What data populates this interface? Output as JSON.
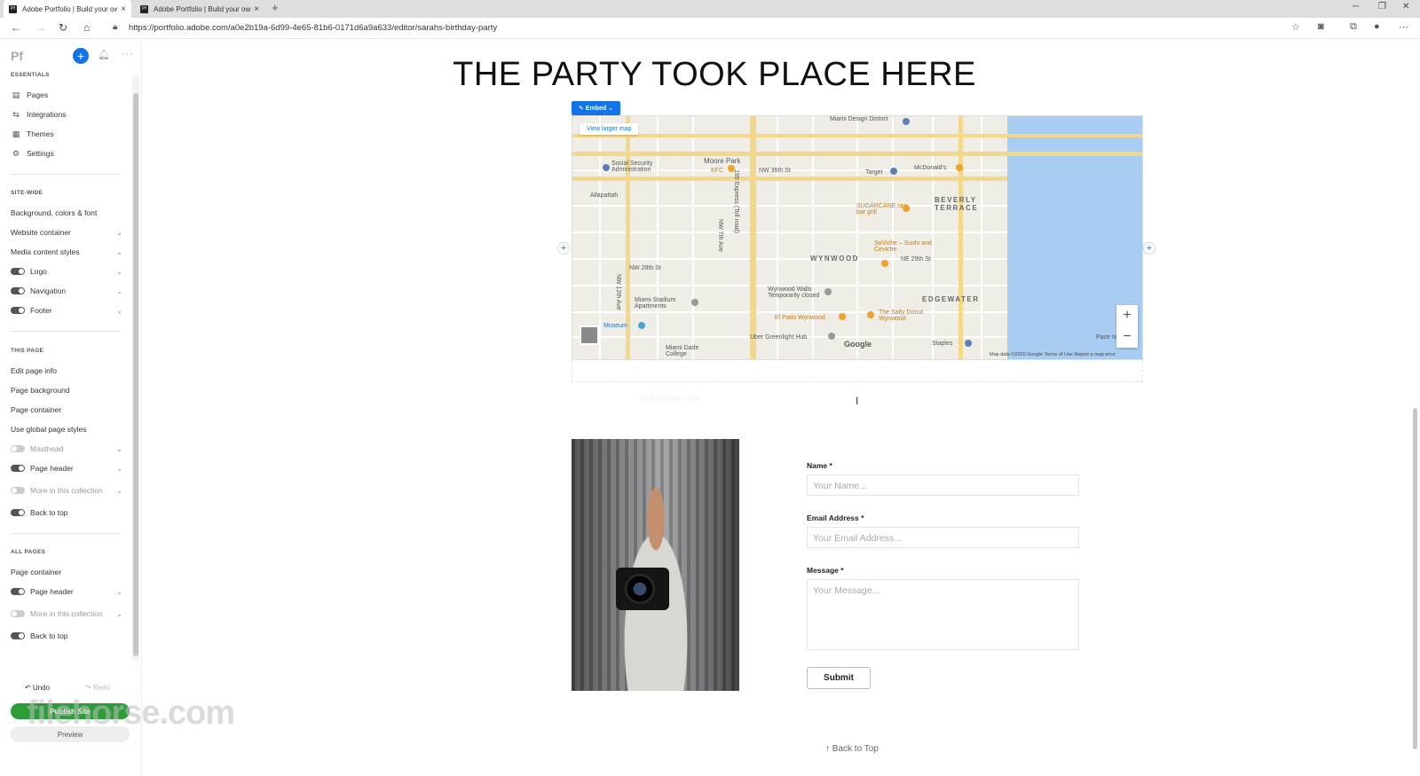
{
  "browser": {
    "tabs": [
      {
        "title": "Adobe Portfolio | Build your own",
        "favicon": "Pf"
      },
      {
        "title": "Adobe Portfolio | Build your own",
        "favicon": "Pf"
      }
    ],
    "url": "https://portfolio.adobe.com/a0e2b19a-6d99-4e65-81b6-0171d6a9a633/editor/sarahs-birthday-party"
  },
  "sidebar": {
    "logo": "Pf",
    "essentials_heading": "ESSENTIALS",
    "essentials": [
      {
        "label": "Pages",
        "icon": "page-icon"
      },
      {
        "label": "Integrations",
        "icon": "integrations-icon"
      },
      {
        "label": "Themes",
        "icon": "themes-icon"
      },
      {
        "label": "Settings",
        "icon": "gear-icon"
      }
    ],
    "sitewide_heading": "SITE-WIDE",
    "sitewide": [
      {
        "label": "Background, colors & font"
      },
      {
        "label": "Website container"
      },
      {
        "label": "Media content styles"
      },
      {
        "label": "Logo",
        "toggle": true
      },
      {
        "label": "Navigation",
        "toggle": true
      },
      {
        "label": "Footer",
        "toggle": true
      }
    ],
    "thispage_heading": "THIS PAGE",
    "thispage": [
      {
        "label": "Edit page info"
      },
      {
        "label": "Page background"
      },
      {
        "label": "Page container"
      },
      {
        "label": "Use global page styles"
      },
      {
        "label": "Masthead",
        "toggle": false
      },
      {
        "label": "Page header",
        "toggle": true
      },
      {
        "label": "More in this collection",
        "toggle": false
      },
      {
        "label": "Back to top",
        "toggle": true
      }
    ],
    "allpages_heading": "ALL PAGES",
    "allpages": [
      {
        "label": "Page container"
      },
      {
        "label": "Page header",
        "toggle": true
      },
      {
        "label": "More in this collection",
        "toggle": false
      },
      {
        "label": "Back to top",
        "toggle": true
      }
    ],
    "undo": "Undo",
    "redo": "Redo",
    "publish": "Publish Site",
    "preview": "Preview",
    "watermark": "filehorse.com"
  },
  "main": {
    "title": "THE PARTY TOOK PLACE HERE",
    "embed_label": "Embed",
    "map": {
      "view_larger": "View larger map",
      "footer": "Map data ©2020 Google   Terms of Use   Report a map error",
      "brand": "Google",
      "labels": {
        "design_district": "Miami Design District",
        "moore_park": "Moore Park",
        "ssa": "Social Security Administration",
        "allapattah": "Allapattah",
        "wynwood": "WYNWOOD",
        "beverly": "BEVERLY TERRACE",
        "edgewater": "EDGEWATER",
        "target": "Target",
        "mcdonalds": "McDonald's",
        "sugarcane": "SUGARCANE raw bar grill",
        "suviche": "SuViche – Sushi and Ceviche",
        "stadium": "Miami Stadium Apartments",
        "walls": "Wynwood Walls Temporarily closed",
        "pollo": "El Patio Wynwood",
        "donut": "The Salty Donut Wynwood",
        "uber": "Uber Greenlight Hub",
        "museum": "Museum",
        "dade": "Miami Dade College",
        "staples": "Staples",
        "pace": "Pace Island",
        "kfc": "KFC",
        "i195": "195 Express (Toll road)",
        "nw7": "NW 7th Ave",
        "nw12": "NW 12th Ave",
        "nw36": "NW 36th St",
        "nw29": "NW 29th St",
        "ne29": "NE 29th St"
      }
    },
    "caption_placeholder": "Type your text here",
    "form": {
      "name_label": "Name *",
      "name_placeholder": "Your Name...",
      "email_label": "Email Address *",
      "email_placeholder": "Your Email Address...",
      "message_label": "Message *",
      "message_placeholder": "Your Message...",
      "submit": "Submit"
    },
    "back_to_top": "↑ Back to Top"
  }
}
